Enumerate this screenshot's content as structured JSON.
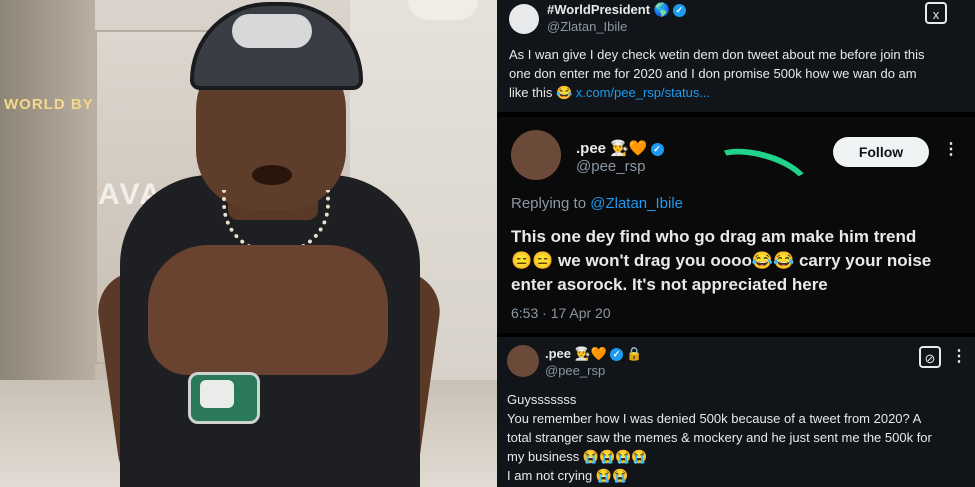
{
  "top_tweet": {
    "display_name": "#WorldPresident 🌎",
    "handle": "@Zlatan_Ibile",
    "text_line1": "As I wan give I dey check wetin dem don tweet about me before join this",
    "text_line2": "one don enter me for 2020 and I don promise 500k how we wan do am",
    "text_line3_prefix": "like this 😂 ",
    "link": "x.com/pee_rsp/status..."
  },
  "quoted_tweet": {
    "display_name": ".pee 👨‍🍳🧡",
    "handle": "@pee_rsp",
    "follow_label": "Follow",
    "replying_prefix": "Replying to ",
    "replying_to": "@Zlatan_Ibile",
    "line1": "This one dey find who go drag am make him trend",
    "line2": "😑😑 we won't drag you oooo😂😂 carry your noise",
    "line3": "enter asorock. It's not appreciated here",
    "timestamp": "6:53 · 17 Apr 20"
  },
  "bottom_tweet": {
    "display_name": ".pee 👨‍🍳🧡",
    "handle": "@pee_rsp",
    "line1": "Guysssssss",
    "line2": "You remember how I was denied 500k because of a tweet from 2020?  A",
    "line3": "total stranger saw the memes & mockery and he just sent me the 500k for",
    "line4": "my business 😭😭😭😭",
    "line5": "I am not crying 😭😭"
  },
  "photo": {
    "store_sign": "WORLD BY",
    "store_letters": "AVA"
  },
  "colors": {
    "accent_blue": "#1d9bf0",
    "scribble_green": "#22d38c",
    "panel_bg": "#111418"
  },
  "icons": [
    "verified-icon",
    "x-logo-icon",
    "more-icon",
    "lock-icon",
    "grok-icon"
  ]
}
